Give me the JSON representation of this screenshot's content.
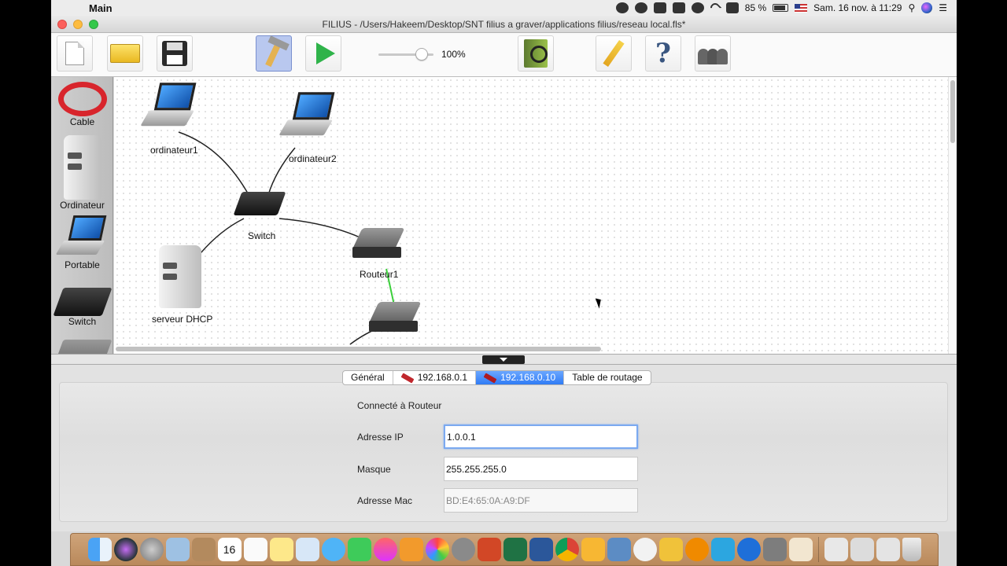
{
  "menubar": {
    "apple_glyph": "",
    "app_name": "Main",
    "battery": "85 %",
    "datetime": "Sam. 16 nov. à 11:29"
  },
  "window": {
    "title": "FILIUS - /Users/Hakeem/Desktop/SNT filius a graver/applications filius/reseau local.fls*"
  },
  "toolbar": {
    "zoom_value": 0.78,
    "zoom_label": "100%"
  },
  "palette": {
    "items": [
      {
        "label": "Cable"
      },
      {
        "label": "Ordinateur"
      },
      {
        "label": "Portable"
      },
      {
        "label": "Switch"
      }
    ]
  },
  "network": {
    "nodes": [
      {
        "label": "ordinateur1"
      },
      {
        "label": "ordinateur2"
      },
      {
        "label": "Switch"
      },
      {
        "label": "Routeur1"
      },
      {
        "label": "serveur DHCP"
      }
    ]
  },
  "panel": {
    "tabs": [
      {
        "label": "Général"
      },
      {
        "label": "192.168.0.1"
      },
      {
        "label": "192.168.0.10"
      },
      {
        "label": "Table de routage"
      }
    ],
    "connected_label": "Connecté à Routeur",
    "ip_label": "Adresse IP",
    "ip_value": "1.0.0.1",
    "mask_label": "Masque",
    "mask_value": "255.255.255.0",
    "mac_label": "Adresse Mac",
    "mac_value": "BD:E4:65:0A:A9:DF"
  },
  "colors": {
    "tab_selected": "#2f7bf5",
    "link_active": "#3ccf3c",
    "cable_red": "#d8252c"
  },
  "dock": {
    "calendar_day": "16",
    "icons": [
      "finder-icon",
      "siri-icon",
      "launchpad-icon",
      "preview-icon",
      "contacts-icon",
      "calendar-icon",
      "reminders-icon",
      "notes-icon",
      "photos-app-icon",
      "messages-icon",
      "facetime-icon",
      "itunes-icon",
      "ibooks-icon",
      "photos-icon",
      "system-preferences-icon",
      "powerpoint-icon",
      "excel-icon",
      "word-icon",
      "chrome-icon",
      "app-icon",
      "image-capture-icon",
      "panda-icon",
      "pencil-app-icon",
      "vlc-icon",
      "migration-icon",
      "quicktime-icon",
      "utility-icon",
      "java-icon",
      "downloads-icon",
      "documents-icon",
      "screenshots-icon",
      "trash-icon"
    ]
  }
}
